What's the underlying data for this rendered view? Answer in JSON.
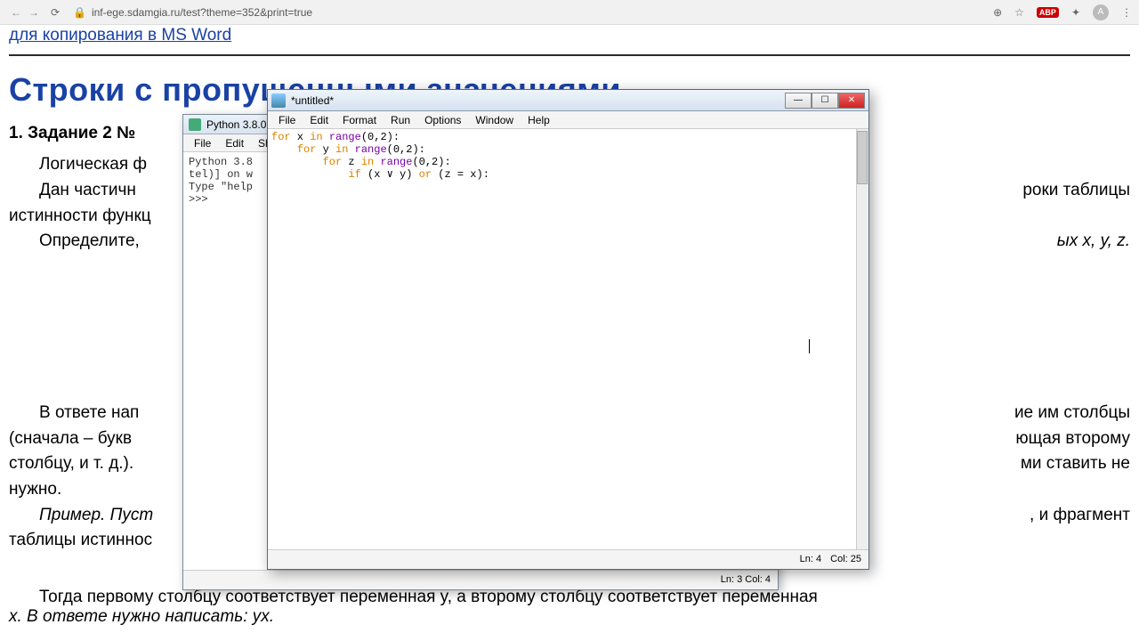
{
  "browser": {
    "url": "inf-ege.sdamgia.ru/test?theme=352&print=true",
    "ext_badge": "ABP",
    "avatar": "A"
  },
  "page": {
    "toplink": "для копирования в MS Word",
    "heading": "Строки с пропущенными значениями",
    "task_title": "1. Задание 2 №",
    "para1": "Логическая ф",
    "para2a": "Дан  частичн",
    "para2b": "роки  таблицы",
    "para3": "истинности функц",
    "para4a": "Определите,",
    "para4b": "ых x, y, z.",
    "para5a": "В ответе нап",
    "para5b": "ие им столбцы",
    "para6a": "(сначала – букв",
    "para6b": "ющая второму",
    "para7a": "столбцу, и т. д.).",
    "para7b": "ми ставить не",
    "para8": "нужно.",
    "para9a": "Пример. Пуст",
    "para9b": ", и фрагмент",
    "para10": "таблицы истиннос",
    "bottom1": "Тогда первому столбцу соответствует переменная y, а второму столбцу соответствует переменная",
    "bottom2": "x. В ответе нужно написать: yx."
  },
  "shell": {
    "title": "Python 3.8.0",
    "menus": [
      "File",
      "Edit",
      "Sh"
    ],
    "line1": "Python 3.8",
    "line2": "tel)] on w",
    "line3": "Type \"help",
    "prompt": ">>>",
    "status": "Ln: 3   Col: 4"
  },
  "editor": {
    "title": "*untitled*",
    "menus": [
      "File",
      "Edit",
      "Format",
      "Run",
      "Options",
      "Window",
      "Help"
    ],
    "code": {
      "l1_kw1": "for",
      "l1_rest": " x ",
      "l1_kw2": "in",
      "l1_rest2": " ",
      "l1_fn": "range",
      "l1_args": "(0,2):",
      "l2_pad": "    ",
      "l2_kw1": "for",
      "l2_rest": " y ",
      "l2_kw2": "in",
      "l2_rest2": " ",
      "l2_fn": "range",
      "l2_args": "(0,2):",
      "l3_pad": "        ",
      "l3_kw1": "for",
      "l3_rest": " z ",
      "l3_kw2": "in",
      "l3_rest2": " ",
      "l3_fn": "range",
      "l3_args": "(0,2):",
      "l4_pad": "            ",
      "l4_kw1": "if",
      "l4_cond1": " (x ∨ y) ",
      "l4_kw2": "or",
      "l4_cond2": " (z = x):"
    },
    "status_ln": "Ln: 4",
    "status_col": "Col: 25"
  }
}
